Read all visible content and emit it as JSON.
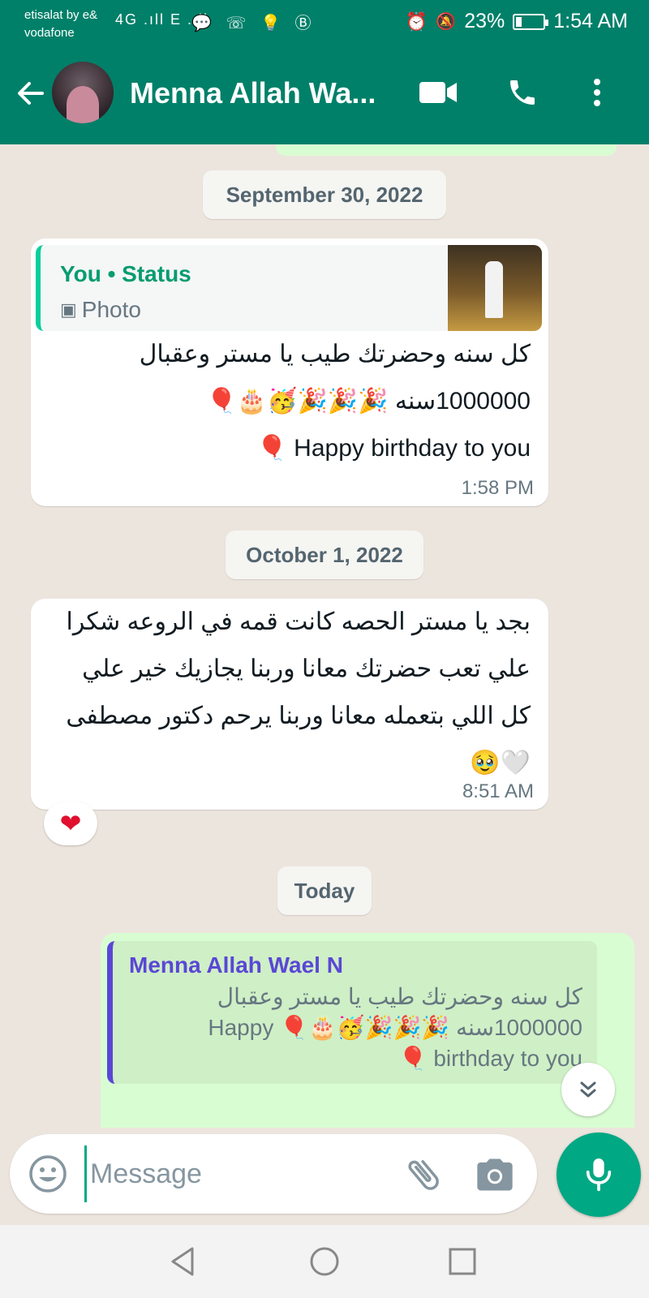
{
  "status_bar": {
    "carrier_line1": "etisalat by e&",
    "carrier_line2": "vodafone",
    "signal_text": "4G .ıll E .ıll",
    "app_icons": "💬 ☏ 💡 Ⓑ",
    "alarm_icon": "⏰",
    "mute_icon": "🔕",
    "battery_percent": "23%",
    "battery_level": 0.23,
    "time": "1:54 AM"
  },
  "header": {
    "contact_name": "Menna Allah Wa...",
    "icons": [
      "back-arrow-icon",
      "video-call-icon",
      "voice-call-icon",
      "more-options-icon"
    ]
  },
  "chat": {
    "date_1": "September 30, 2022",
    "msg1": {
      "quote_author": "You • Status",
      "quote_type_icon": "▣",
      "quote_type": "Photo",
      "line1": "كل سنه وحضرتك طيب يا مستر وعقبال",
      "line2": "1000000سنه 🎉🎉🎉🥳🎂🎈",
      "line3": "Happy birthday to you 🎈",
      "time": "1:58 PM"
    },
    "date_2": "October 1, 2022",
    "msg2": {
      "line1": "بجد يا مستر الحصه كانت قمه في الروعه شكرا",
      "line2": "علي تعب حضرتك معانا وربنا يجازيك خير علي",
      "line3": "كل اللي بتعمله معانا وربنا يرحم دكتور مصطفى",
      "line4": "🤍🥹",
      "time": "8:51 AM",
      "reaction": "❤"
    },
    "date_3": "Today",
    "msg3": {
      "quote_author": "Menna Allah Wael N",
      "quote_line1": "كل سنه وحضرتك طيب يا مستر وعقبال",
      "quote_line2": "1000000سنه 🎉🎉🎉🥳🎂🎈 Happy",
      "quote_line3": "birthday to you 🎈"
    }
  },
  "input": {
    "placeholder": "Message"
  },
  "colors": {
    "header_green": "#008069",
    "outgoing_bubble": "#D9FDD3",
    "accent": "#00A884",
    "chat_background": "#ECE5DD"
  }
}
